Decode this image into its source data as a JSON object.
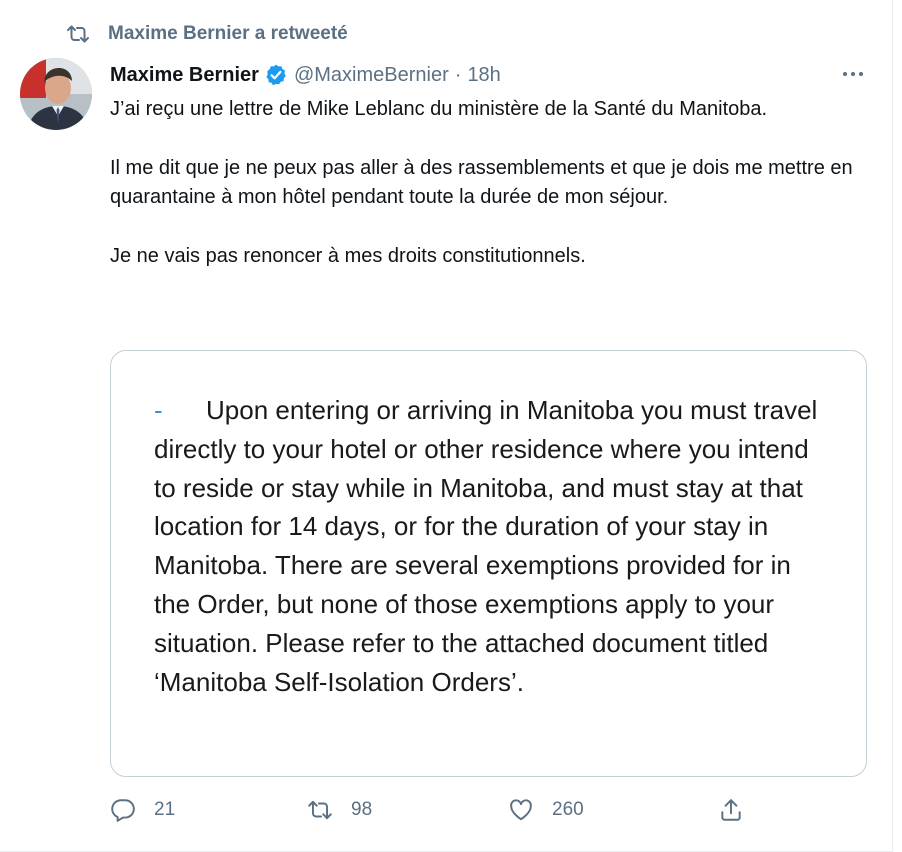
{
  "retweet": {
    "label": "Maxime Bernier a retweeté"
  },
  "tweet": {
    "name": "Maxime Bernier",
    "handle": "@MaximeBernier",
    "separator": "·",
    "time": "18h",
    "paragraphs": [
      "J’ai reçu une lettre de Mike Leblanc du ministère de la Santé du Manitoba.",
      "Il me dit que je ne peux pas aller à des rassemblements et que je dois me mettre en quarantaine à mon hôtel pendant toute la durée de mon séjour.",
      "Je ne vais pas renoncer à mes droits constitutionnels."
    ],
    "image": {
      "dash": "-",
      "text": "Upon entering or arriving in Manitoba you must travel directly to your hotel or other residence where you intend to reside or stay while in Manitoba, and must stay at that location for 14 days, or for the duration of your stay in Manitoba. There are several exemptions provided for in the Order, but none of those exemptions apply to your situation. Please refer to the attached document titled ‘Manitoba Self-Isolation Orders’."
    }
  },
  "actions": {
    "reply": {
      "icon": "reply-icon",
      "count": "21"
    },
    "retweet": {
      "icon": "retweet-icon",
      "count": "98"
    },
    "like": {
      "icon": "heart-icon",
      "count": "260"
    },
    "share": {
      "icon": "share-icon"
    }
  },
  "colors": {
    "secondary_text": "#5b7083",
    "verified": "#1d9bf0",
    "border": "#c4cfd6"
  }
}
